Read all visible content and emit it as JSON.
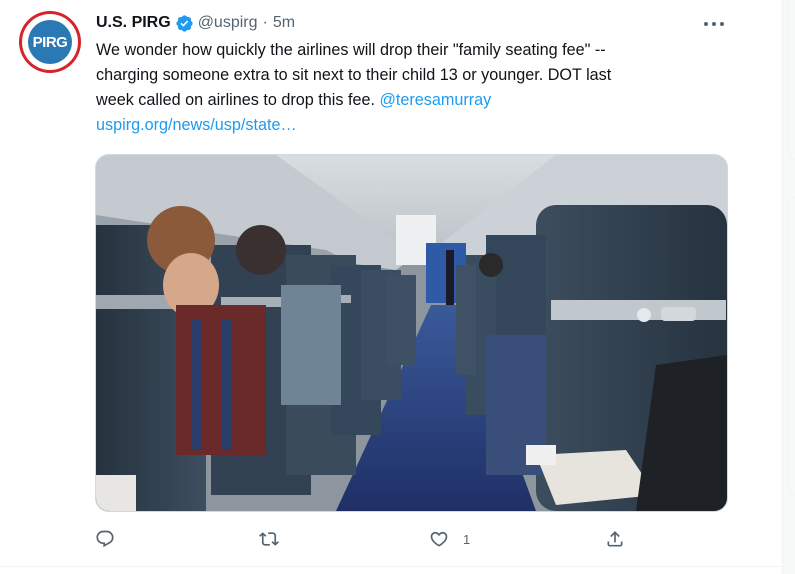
{
  "tweet": {
    "author": {
      "display_name": "U.S. PIRG",
      "handle": "@uspirg",
      "avatar_text": "PIRG",
      "verified": true
    },
    "separator": "·",
    "time": "5m",
    "text_lines": [
      "We wonder how quickly the airlines will drop their \"family seating fee\" --",
      "charging someone extra to sit next to their child 13 or younger. DOT last",
      "week called on airlines to drop this fee. "
    ],
    "mention": "@teresamurray",
    "url": "uspirg.org/news/usp/state…",
    "photo_description_icon": "airplane-cabin-photo",
    "actions": {
      "reply_icon": "reply-icon",
      "retweet_icon": "retweet-icon",
      "like_icon": "heart-icon",
      "like_count": "1",
      "share_icon": "share-icon"
    }
  },
  "colors": {
    "link": "#1d9bf0",
    "verified": "#1d9bf0",
    "text": "#0f1419",
    "secondary": "#536471",
    "avatar_ring": "#d8232a",
    "avatar_core": "#2a78b4"
  }
}
